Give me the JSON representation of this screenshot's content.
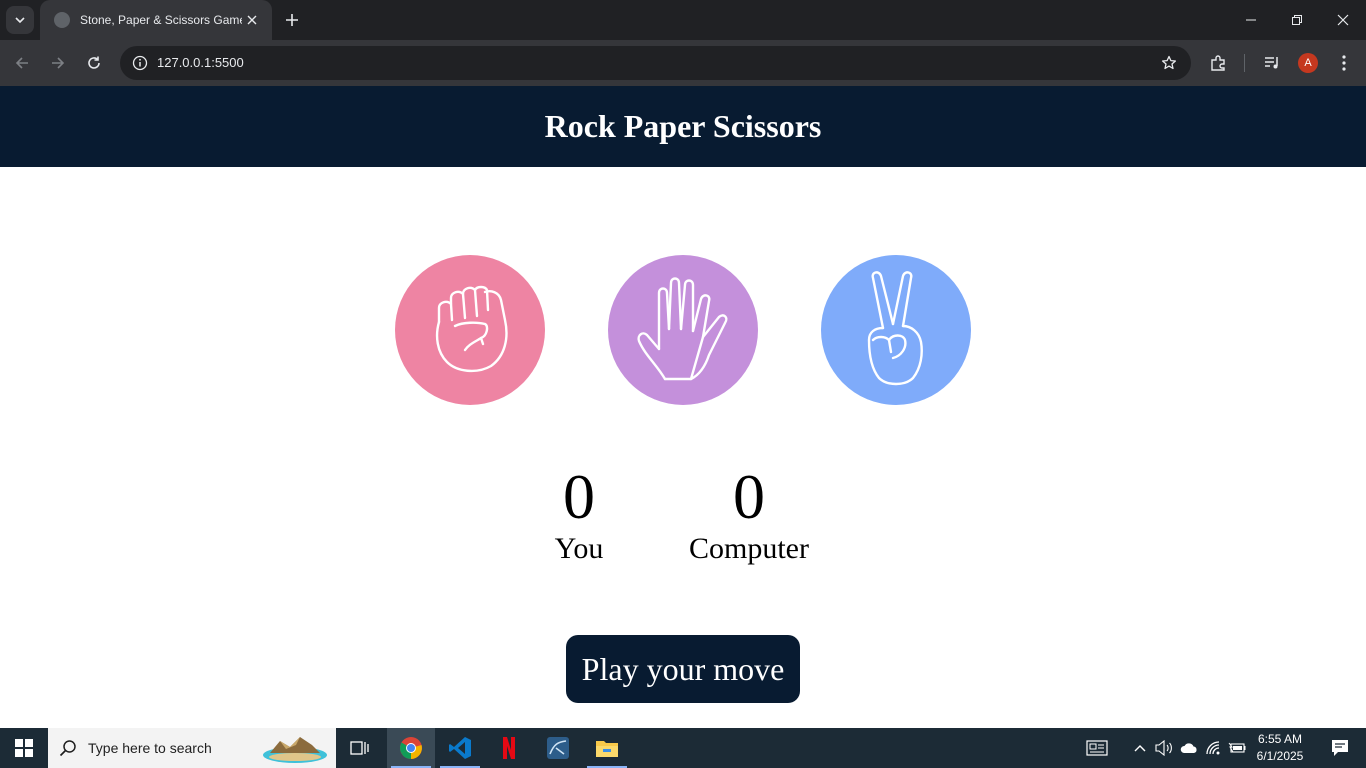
{
  "browser": {
    "tab_title": "Stone, Paper & Scissors Game",
    "url": "127.0.0.1:5500",
    "profile_initial": "A"
  },
  "app": {
    "title": "Rock Paper Scissors",
    "choices": [
      {
        "name": "rock",
        "icon": "fist-icon",
        "color": "#ee84a3"
      },
      {
        "name": "paper",
        "icon": "open-hand-icon",
        "color": "#c490db"
      },
      {
        "name": "scissors",
        "icon": "peace-hand-icon",
        "color": "#7fabfa"
      }
    ],
    "scores": {
      "user_value": "0",
      "user_label": "You",
      "computer_value": "0",
      "computer_label": "Computer"
    },
    "message": "Play your move",
    "colors": {
      "header": "#081b31",
      "message_bg": "#081b31"
    }
  },
  "taskbar": {
    "search_placeholder": "Type here to search",
    "time": "6:55 AM",
    "date": "6/1/2025",
    "apps": [
      "task-view",
      "chrome",
      "vscode",
      "netflix",
      "mysql-workbench",
      "file-explorer"
    ]
  }
}
